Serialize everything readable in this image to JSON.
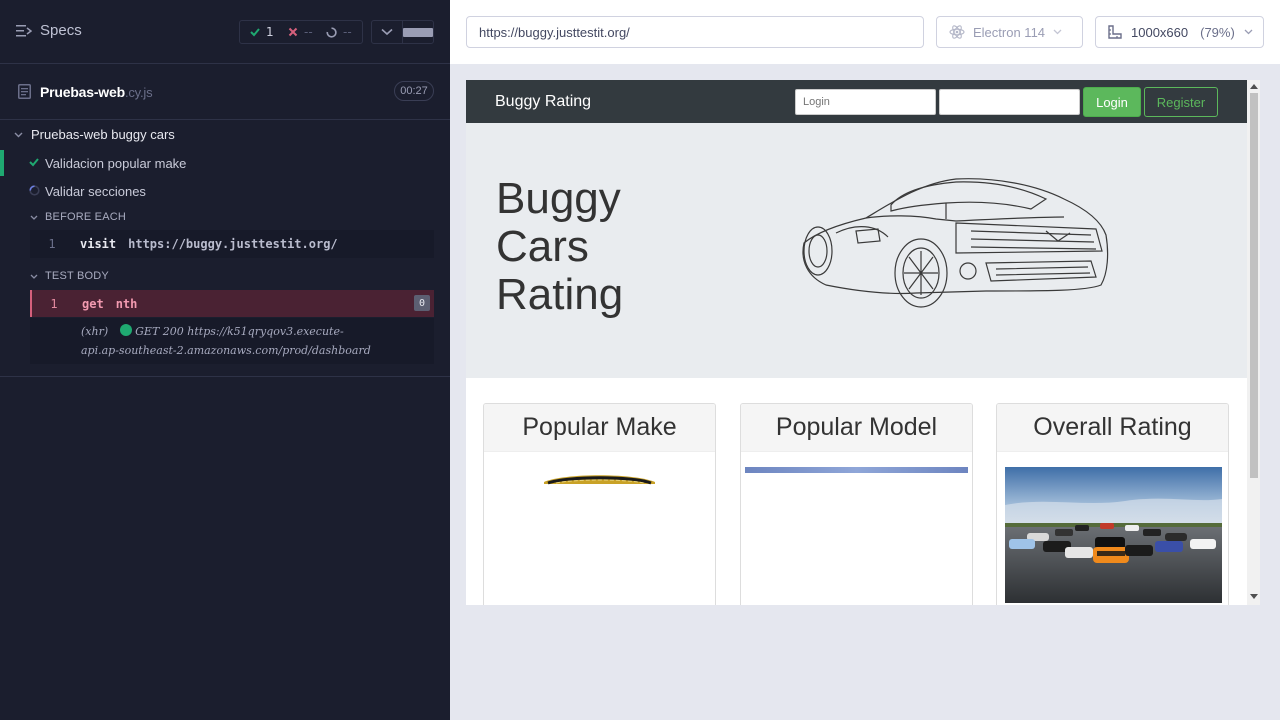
{
  "reporter": {
    "specs_label": "Specs",
    "stats": {
      "passed": "1",
      "failed": "--",
      "pending": "--"
    },
    "file": {
      "name": "Pruebas-web",
      "ext": ".cy.js",
      "duration": "00:27"
    },
    "suite": "Pruebas-web buggy cars",
    "tests": [
      {
        "title": "Validacion popular make",
        "state": "passed"
      },
      {
        "title": "Validar secciones",
        "state": "running"
      }
    ],
    "before_each": {
      "label": "BEFORE EACH",
      "commands": [
        {
          "num": "1",
          "name": "visit",
          "message": "https://buggy.justtestit.org/"
        }
      ]
    },
    "test_body": {
      "label": "TEST BODY",
      "commands": [
        {
          "num": "1",
          "name": "get",
          "message": "nth",
          "badge": "0"
        }
      ],
      "xhr": {
        "label": "(xhr)",
        "line1": "GET 200 https://k51qryqov3.execute-",
        "line2": "api.ap-southeast-2.amazonaws.com/prod/dashboard"
      }
    },
    "colors": {
      "bg": "#1b1e2e",
      "pass": "#1fa971",
      "fail": "#d6607c"
    }
  },
  "toolbar": {
    "url": "https://buggy.justtestit.org/",
    "browser": "Electron 114",
    "viewport": "1000x660",
    "scale": "(79%)"
  },
  "aut": {
    "brand": "Buggy Rating",
    "login_placeholder": "Login",
    "password_placeholder": "",
    "login_button": "Login",
    "register_button": "Register",
    "hero_title": [
      "Buggy",
      "Cars",
      "Rating"
    ],
    "cards": [
      {
        "title": "Popular Make"
      },
      {
        "title": "Popular Model"
      },
      {
        "title": "Overall Rating"
      }
    ],
    "colors": {
      "navbar": "#333a3f",
      "success": "#5cb85c",
      "hero_bg": "#e9ecef"
    }
  }
}
